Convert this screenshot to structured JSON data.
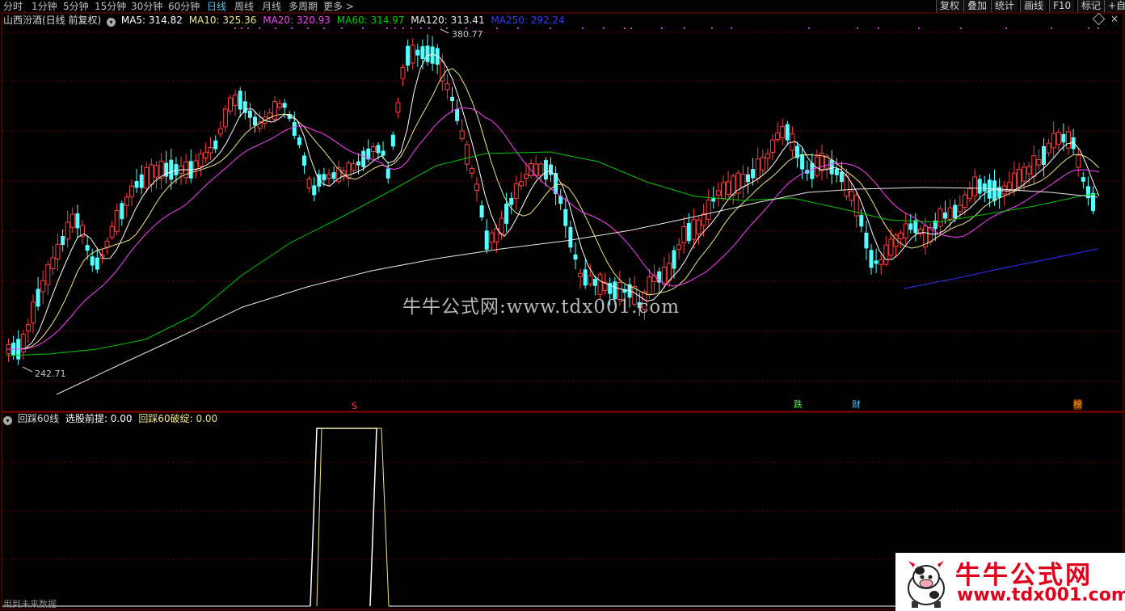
{
  "periods": [
    {
      "label": "分时",
      "active": false
    },
    {
      "label": "1分钟",
      "active": false
    },
    {
      "label": "5分钟",
      "active": false
    },
    {
      "label": "15分钟",
      "active": false
    },
    {
      "label": "30分钟",
      "active": false
    },
    {
      "label": "60分钟",
      "active": false
    },
    {
      "label": "日线",
      "active": true
    },
    {
      "label": "周线",
      "active": false
    },
    {
      "label": "月线",
      "active": false
    },
    {
      "label": "多周期",
      "active": false
    },
    {
      "label": "更多 >",
      "active": false
    }
  ],
  "tools": [
    "复权",
    "叠加",
    "统计",
    "画线",
    "F10",
    "标记",
    "+自"
  ],
  "main_legend": {
    "title": "山西汾酒(日线 前复权)",
    "ma5": "MA5: 314.82",
    "ma10": "MA10: 325.36",
    "ma20": "MA20: 320.93",
    "ma60": "MA60: 314.97",
    "ma120": "MA120: 313.41",
    "ma250": "MA250: 292.24"
  },
  "colors": {
    "up": "#ff3c3c",
    "down": "#54ffff",
    "grid": "#7a0000",
    "ma5": "#ffffff",
    "ma10": "#f0e68c",
    "ma20": "#ff40ff",
    "ma60": "#00c800",
    "ma120": "#e8e8e8",
    "ma250": "#3030ff"
  },
  "price_labels": {
    "high": "380.77",
    "low": "242.71"
  },
  "event_markers": [
    {
      "text": "S",
      "color": "#ff3c3c"
    },
    {
      "text": "跌",
      "color": "#40ff40"
    },
    {
      "text": "财",
      "color": "#54c8ff"
    },
    {
      "text": "榜",
      "color": "#ffa000"
    }
  ],
  "indicator_legend": {
    "name": "回踩60线",
    "cond1": "选股前提: 0.00",
    "cond2": "回踩60破绽: 0.00"
  },
  "watermark": "牛牛公式网:www.tdx001.com",
  "logo": {
    "line1": "牛牛公式网",
    "line2": "www.tdx001.com"
  },
  "bottom_note": "用到未来数据",
  "chart_data": {
    "type": "candlestick",
    "title": "山西汾酒(日线 前复权)",
    "price_range": [
      225,
      390
    ],
    "highest": 380.77,
    "lowest": 242.71,
    "ma_latest": {
      "MA5": 314.82,
      "MA10": 325.36,
      "MA20": 320.93,
      "MA60": 314.97,
      "MA120": 313.41,
      "MA250": 292.24
    },
    "indicator": {
      "name": "回踩60线",
      "values": {
        "选股前提": 0.0,
        "回踩60破绽": 0.0
      },
      "range": [
        0,
        1
      ]
    }
  }
}
